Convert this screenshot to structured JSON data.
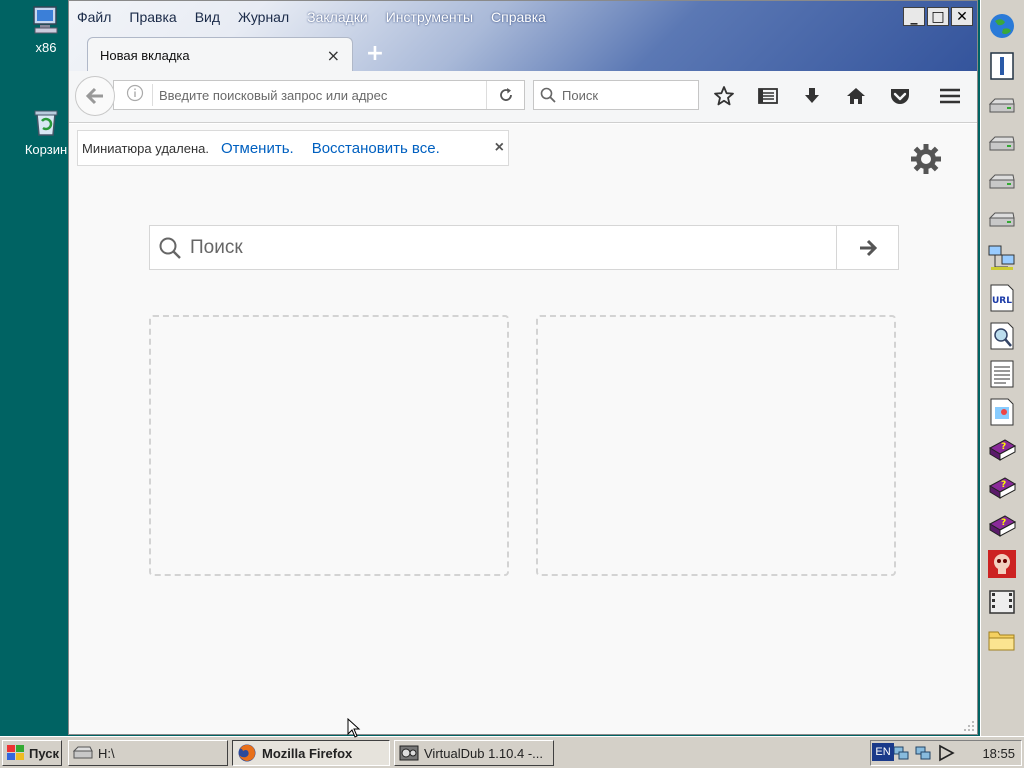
{
  "desktop": {
    "icons": [
      {
        "label": "x86",
        "icon": "computer-icon"
      },
      {
        "label": "Корзин",
        "icon": "recycle-bin-icon"
      }
    ]
  },
  "browser": {
    "menu": [
      "Файл",
      "Правка",
      "Вид",
      "Журнал",
      "Закладки",
      "Инструменты",
      "Справка"
    ],
    "window_controls": {
      "minimize": "_",
      "maximize": "□",
      "close": "✕"
    },
    "tab": {
      "title": "Новая вкладка",
      "close": "×"
    },
    "new_tab": "+",
    "urlbar": {
      "placeholder": "Введите поисковый запрос или адрес"
    },
    "searchbar": {
      "placeholder": "Поиск"
    },
    "notification": {
      "message": "Миниатюра удалена.",
      "undo": "Отменить.",
      "restore_all": "Восстановить все.",
      "close": "×"
    },
    "content_search": {
      "placeholder": "Поиск"
    }
  },
  "taskbar": {
    "start": "Пуск",
    "buttons": [
      {
        "label": "H:\\",
        "icon": "drive-icon"
      },
      {
        "label": "Mozilla Firefox",
        "icon": "firefox-icon",
        "active": true
      },
      {
        "label": "VirtualDub 1.10.4 -...",
        "icon": "virtualdub-icon"
      }
    ],
    "lang": "EN",
    "clock": "18:55"
  },
  "colors": {
    "desktop": "#006363",
    "link": "#0060c0",
    "titlebar_dark": "#34549c"
  }
}
